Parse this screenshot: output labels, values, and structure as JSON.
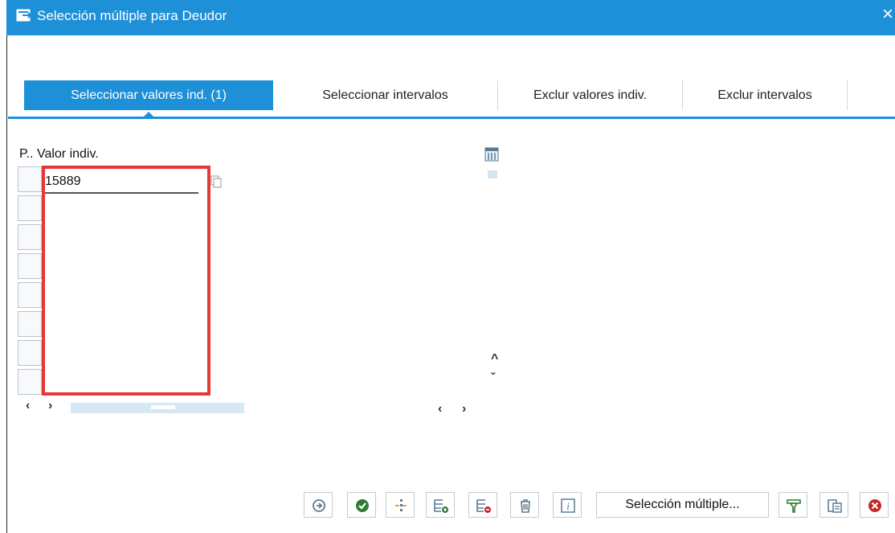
{
  "window": {
    "title": "Selección múltiple para Deudor",
    "close_glyph": "×"
  },
  "tabs": [
    {
      "label": "Seleccionar valores ind. (1)",
      "active": true
    },
    {
      "label": "Seleccionar intervalos",
      "active": false
    },
    {
      "label": "Exclur valores indiv.",
      "active": false
    },
    {
      "label": "Exclur intervalos",
      "active": false
    }
  ],
  "table": {
    "col_position": "P..",
    "col_value": "Valor indiv.",
    "rows": [
      "15889",
      "",
      "",
      "",
      "",
      "",
      "",
      ""
    ]
  },
  "scroll": {
    "left": "‹",
    "right": "›",
    "up": "^",
    "down": "ˇ"
  },
  "toolbar": {
    "buttons": [
      {
        "icon": "execute-icon",
        "name": "execute-button"
      },
      {
        "icon": "check-icon",
        "name": "accept-button"
      },
      {
        "icon": "insert-line-icon",
        "name": "insert-line-button"
      },
      {
        "icon": "add-row-icon",
        "name": "add-row-button"
      },
      {
        "icon": "delete-row-icon",
        "name": "delete-row-button"
      },
      {
        "icon": "trash-icon",
        "name": "delete-all-button"
      },
      {
        "icon": "info-icon",
        "name": "info-button"
      },
      {
        "icon": "filter-icon",
        "name": "filter-button"
      },
      {
        "icon": "import-clipboard-icon",
        "name": "import-clipboard-button"
      },
      {
        "icon": "cancel-icon",
        "name": "cancel-button"
      }
    ],
    "multi_select_label": "Selección múltiple..."
  },
  "colors": {
    "accent": "#1e90d8",
    "highlight": "#e53935",
    "accept": "#2e7d32",
    "cancel": "#c62828"
  }
}
